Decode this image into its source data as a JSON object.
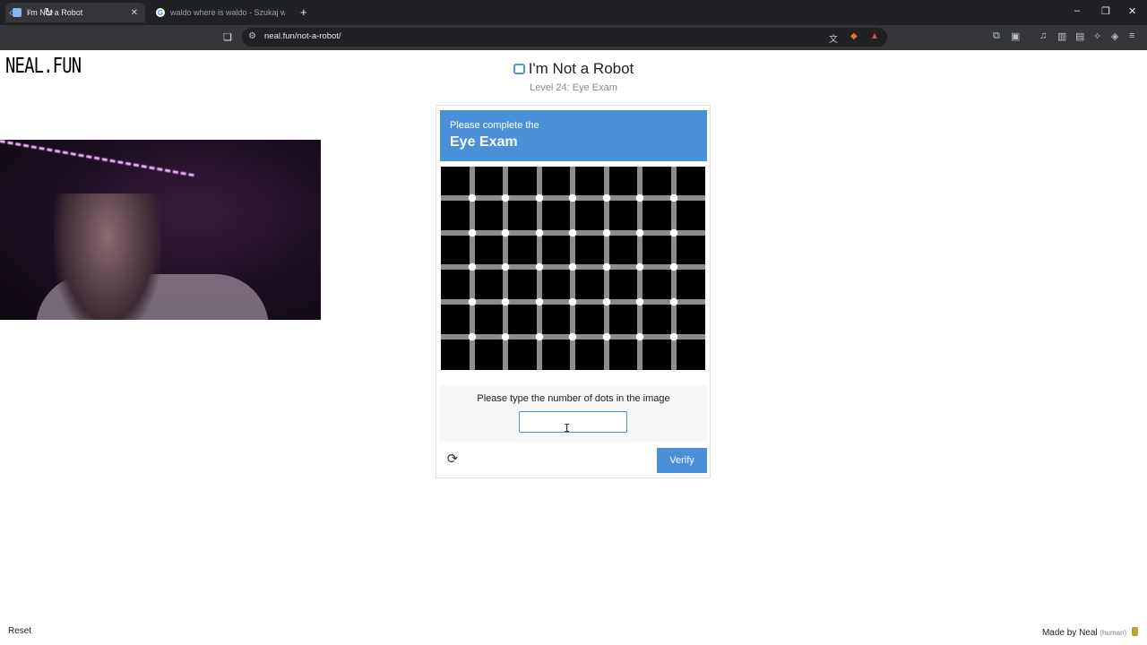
{
  "browser": {
    "tabs": [
      {
        "title": "I'm Not a Robot",
        "active": true
      },
      {
        "title": "waldo where is waldo - Szukaj w Goo",
        "active": false
      }
    ],
    "new_tab_symbol": "+",
    "url": "neal.fun/not-a-robot/",
    "window_controls": {
      "minimize": "–",
      "restore": "❐",
      "close": "✕"
    }
  },
  "page": {
    "logo": "NEAL.FUN",
    "title": "I'm Not a Robot",
    "subtitle": "Level 24: Eye Exam"
  },
  "captcha": {
    "header_line1": "Please complete the",
    "header_line2": "Eye Exam",
    "instruction": "Please type the number of dots in the image",
    "answer_value": "",
    "verify_label": "Verify",
    "refresh_icon": "refresh-icon"
  },
  "footer": {
    "reset_label": "Reset",
    "made_by": "Made by Neal",
    "made_by_note": "(human)"
  },
  "colors": {
    "accent": "#4a90d9",
    "chrome_dark": "#202124",
    "chrome_toolbar": "#35363a",
    "grid_line": "#8c8c8c",
    "grid_dot": "#ffffff"
  }
}
